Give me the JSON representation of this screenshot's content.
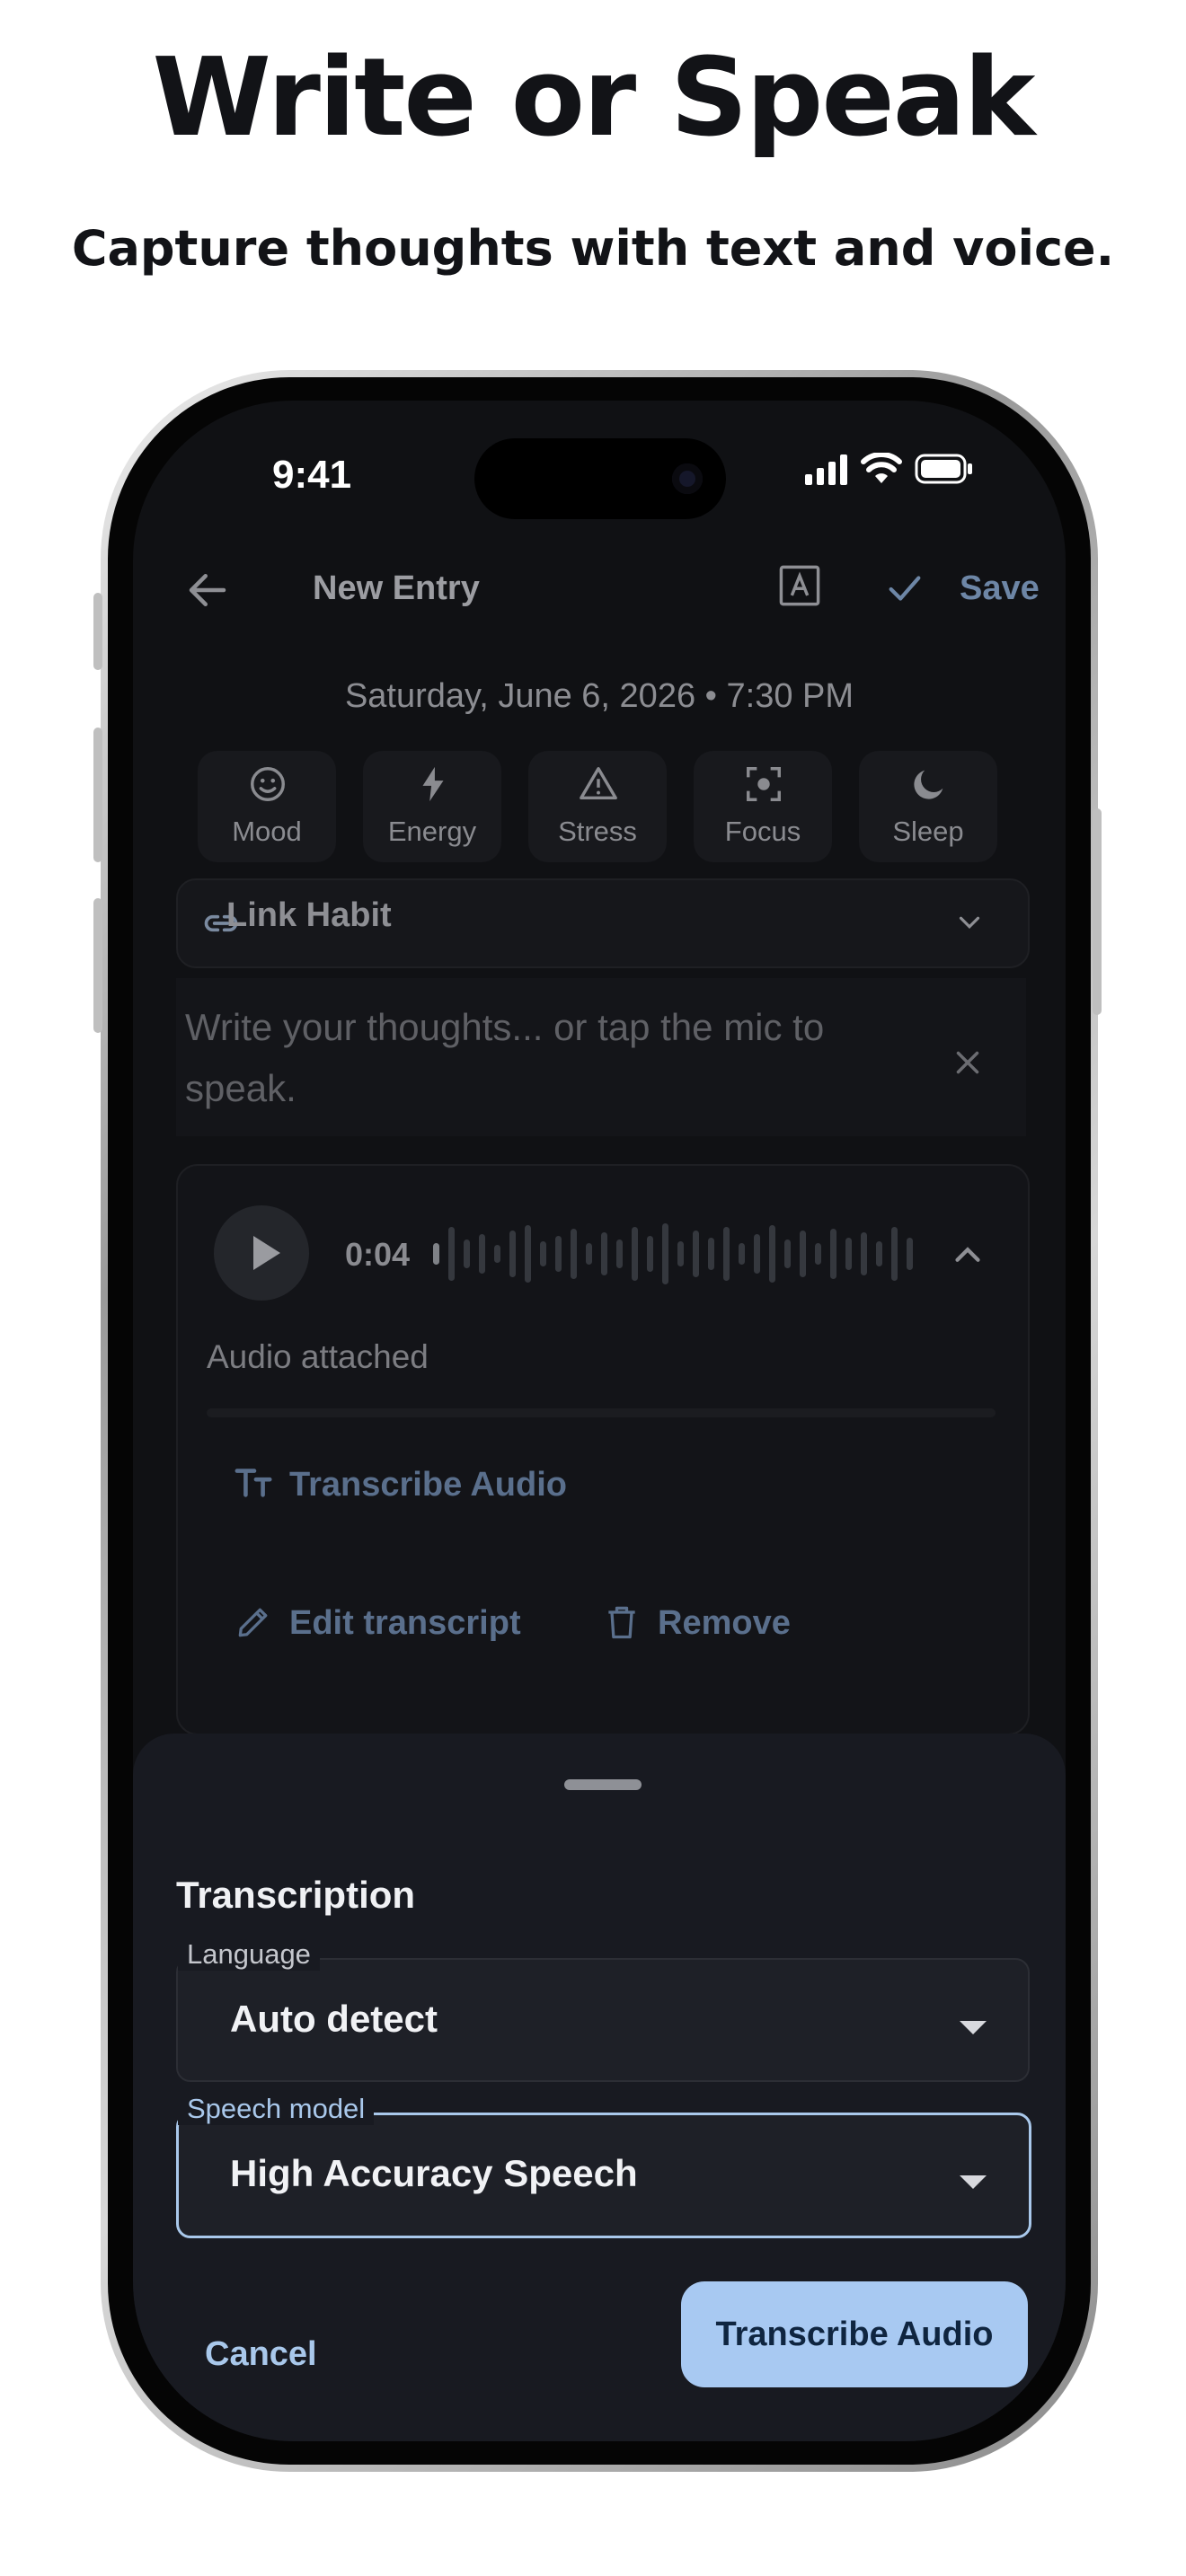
{
  "marketing": {
    "headline": "Write or Speak",
    "subheadline": "Capture thoughts with text and voice."
  },
  "status_bar": {
    "time": "9:41"
  },
  "app_bar": {
    "title": "New Entry",
    "save_label": "Save"
  },
  "entry": {
    "datetime": "Saturday, June 6, 2026 • 7:30 PM"
  },
  "metrics": [
    {
      "label": "Mood",
      "icon": "smiley-icon"
    },
    {
      "label": "Energy",
      "icon": "bolt-icon"
    },
    {
      "label": "Stress",
      "icon": "warning-icon"
    },
    {
      "label": "Focus",
      "icon": "focus-icon"
    },
    {
      "label": "Sleep",
      "icon": "moon-icon"
    }
  ],
  "link_habit": {
    "label": "Link Habit"
  },
  "editor": {
    "placeholder": "Write your thoughts... or tap the mic to speak."
  },
  "audio": {
    "duration": "0:04",
    "status": "Audio attached",
    "transcribe_label": "Transcribe Audio",
    "edit_label": "Edit transcript",
    "remove_label": "Remove"
  },
  "sheet": {
    "title": "Transcription",
    "language_label": "Language",
    "language_value": "Auto detect",
    "model_label": "Speech model",
    "model_value": "High Accuracy Speech",
    "cancel_label": "Cancel",
    "confirm_label": "Transcribe Audio"
  },
  "colors": {
    "accent": "#a8c9f2",
    "sheet_bg": "#181a21",
    "screen_bg": "#101114"
  }
}
